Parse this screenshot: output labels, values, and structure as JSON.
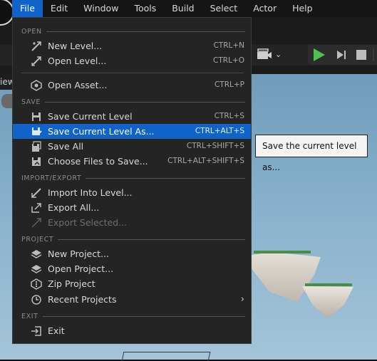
{
  "menubar": {
    "items": [
      "File",
      "Edit",
      "Window",
      "Tools",
      "Build",
      "Select",
      "Actor",
      "Help"
    ],
    "active_index": 0
  },
  "viewport": {
    "tab_label": "iew"
  },
  "file_menu": {
    "sections": [
      {
        "header": "OPEN",
        "entries": [
          {
            "label": "New Level...",
            "shortcut": "CTRL+N",
            "icon": "new-level-icon"
          },
          {
            "label": "Open Level...",
            "shortcut": "CTRL+O",
            "icon": "open-level-icon"
          }
        ],
        "extra": [
          {
            "label": "Open Asset...",
            "shortcut": "CTRL+P",
            "icon": "open-asset-icon"
          }
        ]
      },
      {
        "header": "SAVE",
        "entries": [
          {
            "label": "Save Current Level",
            "shortcut": "CTRL+S",
            "icon": "save-icon"
          },
          {
            "label": "Save Current Level As...",
            "shortcut": "CTRL+ALT+S",
            "icon": "save-as-icon",
            "highlighted": true
          },
          {
            "label": "Save All",
            "shortcut": "CTRL+SHIFT+S",
            "icon": "save-all-icon"
          },
          {
            "label": "Choose Files to Save...",
            "shortcut": "CTRL+ALT+SHIFT+S",
            "icon": "choose-files-icon"
          }
        ]
      },
      {
        "header": "IMPORT/EXPORT",
        "entries": [
          {
            "label": "Import Into Level...",
            "icon": "import-icon"
          },
          {
            "label": "Export All...",
            "icon": "export-icon"
          },
          {
            "label": "Export Selected...",
            "icon": "export-selected-icon",
            "disabled": true
          }
        ]
      },
      {
        "header": "PROJECT",
        "entries": [
          {
            "label": "New Project...",
            "icon": "new-project-icon"
          },
          {
            "label": "Open Project...",
            "icon": "open-project-icon"
          },
          {
            "label": "Zip Project",
            "icon": "zip-project-icon"
          },
          {
            "label": "Recent Projects",
            "icon": "recent-projects-icon",
            "submenu": true
          }
        ]
      },
      {
        "header": "EXIT",
        "entries": [
          {
            "label": "Exit",
            "icon": "exit-icon"
          }
        ]
      }
    ]
  },
  "tooltip": {
    "text": "Save the current level as..."
  },
  "colors": {
    "highlight": "#0f63c9",
    "play": "#4ec24c",
    "menu_bg": "#242424"
  }
}
